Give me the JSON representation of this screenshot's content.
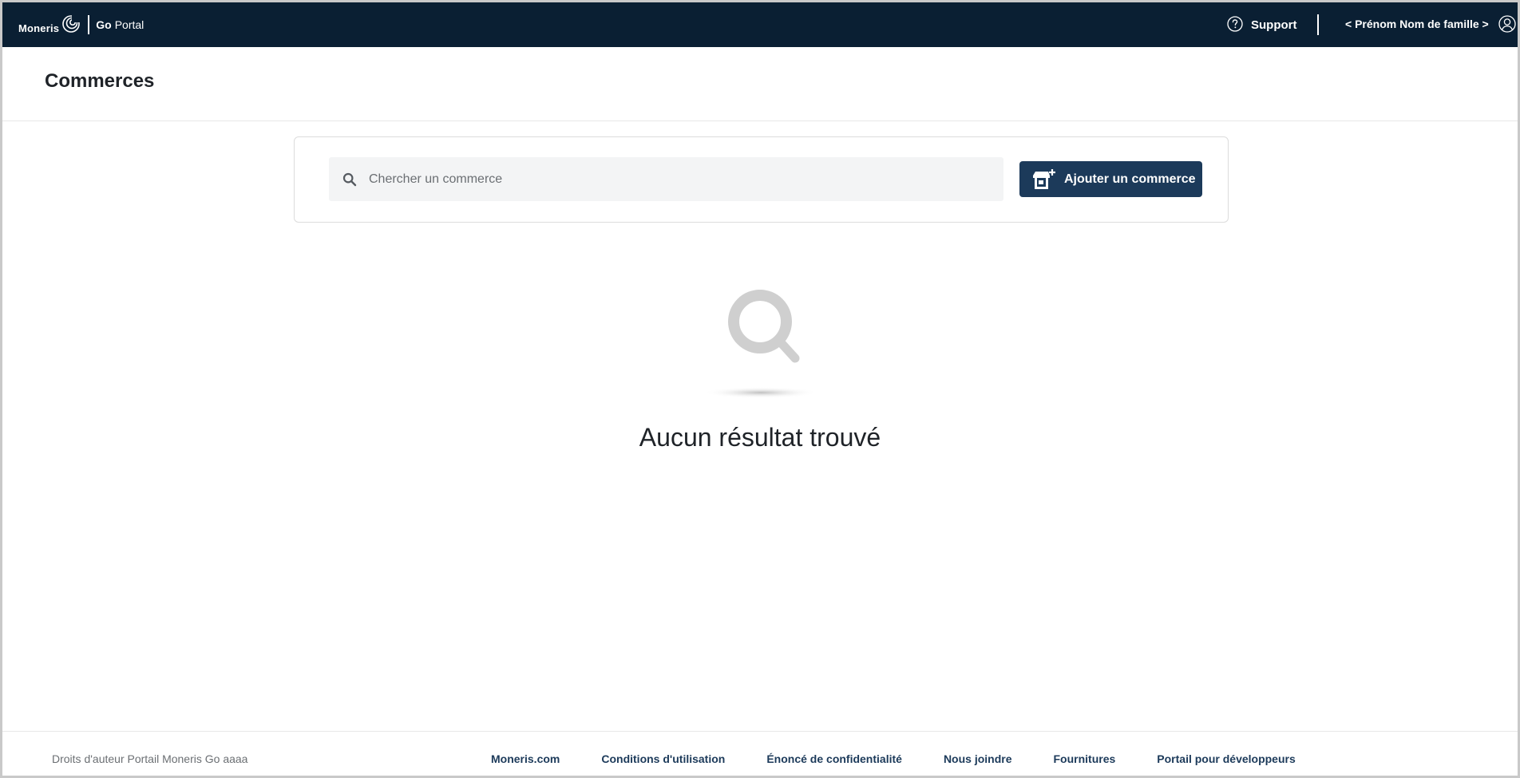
{
  "topbar": {
    "brand_name": "Moneris",
    "product_go": "Go",
    "product_portal": "Portal",
    "support_label": "Support",
    "user_name": "< Prénom Nom de famille >",
    "background_color": "#0a1f33"
  },
  "page": {
    "title": "Commerces"
  },
  "search": {
    "placeholder": "Chercher un commerce",
    "value": ""
  },
  "actions": {
    "add_merchant_label": "Ajouter un commerce",
    "button_color": "#1c3a5a"
  },
  "empty_state": {
    "icon": "search-icon",
    "message": "Aucun résultat trouvé"
  },
  "footer": {
    "copyright": "Droits d'auteur Portail Moneris Go  aaaa",
    "links": [
      {
        "label": "Moneris.com"
      },
      {
        "label": "Conditions d'utilisation"
      },
      {
        "label": "Énoncé de confidentialité"
      },
      {
        "label": "Nous joindre"
      },
      {
        "label": "Fournitures"
      },
      {
        "label": "Portail pour développeurs"
      }
    ]
  }
}
